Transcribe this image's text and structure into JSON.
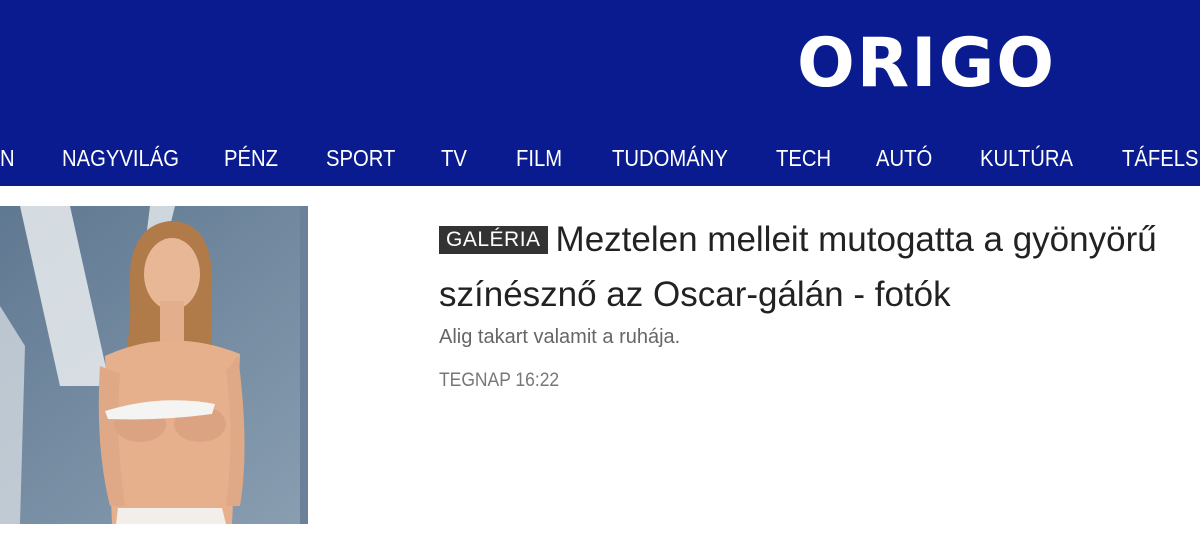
{
  "header": {
    "logo": "ORIGO",
    "background": "#0a1b8f"
  },
  "nav": {
    "items": [
      {
        "label": "N"
      },
      {
        "label": "NAGYVILÁG"
      },
      {
        "label": "PÉNZ"
      },
      {
        "label": "SPORT"
      },
      {
        "label": "TV"
      },
      {
        "label": "FILM"
      },
      {
        "label": "TUDOMÁNY"
      },
      {
        "label": "TECH"
      },
      {
        "label": "AUTÓ"
      },
      {
        "label": "KULTÚRA"
      },
      {
        "label": "TÁFELSP"
      }
    ]
  },
  "article": {
    "badge": "GALÉRIA",
    "title": "Meztelen melleit mutogatta a gyönyörű színésznő az Oscar-gálán - fotók",
    "lead": "Alig takart valamit a ruhája.",
    "time": "TEGNAP 16:22"
  }
}
